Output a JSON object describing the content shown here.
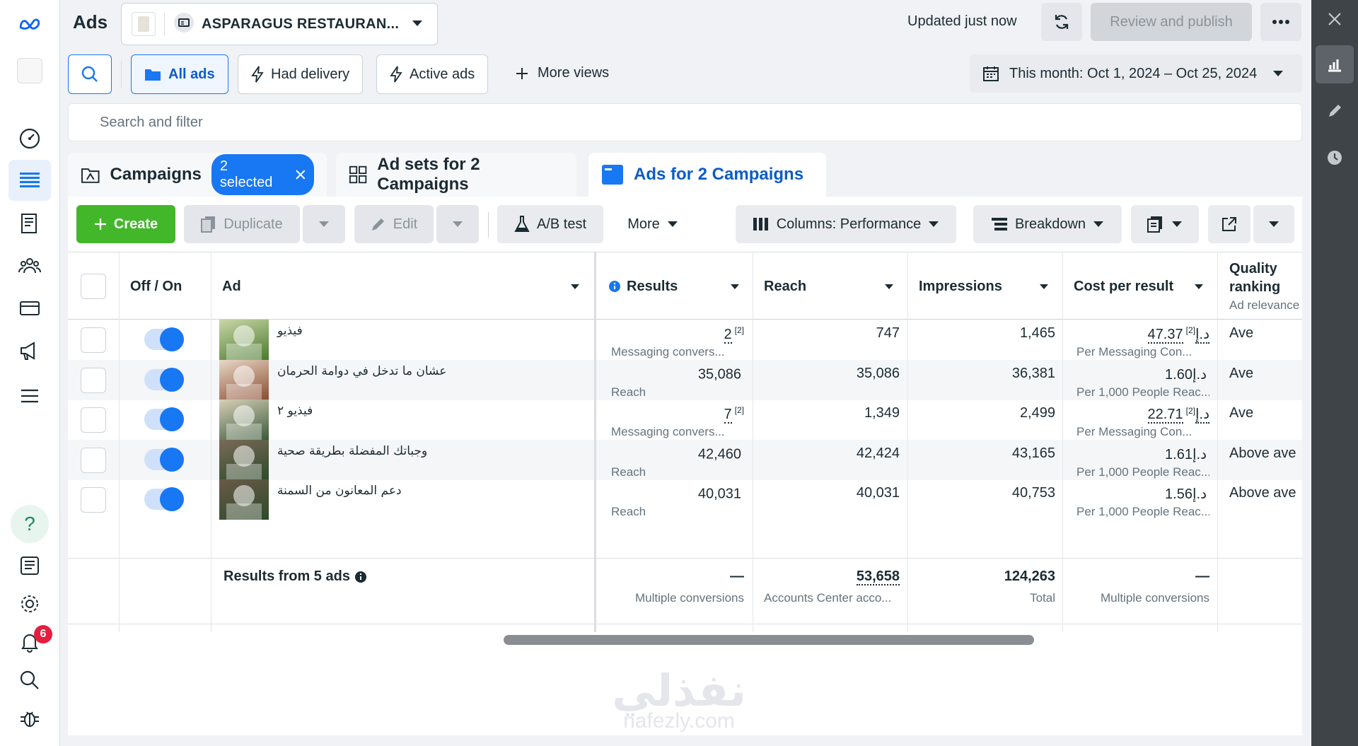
{
  "header": {
    "title": "Ads",
    "account_name": "ASPARAGUS RESTAURAN...",
    "updated": "Updated just now",
    "publish_label": "Review and publish"
  },
  "filters": {
    "all_ads": "All ads",
    "had_delivery": "Had delivery",
    "active_ads": "Active ads",
    "more_views": "More views",
    "date_range": "This month: Oct 1, 2024 – Oct 25, 2024",
    "search_placeholder": "Search and filter"
  },
  "tabs": {
    "campaigns": "Campaigns",
    "selected_pill": "2 selected",
    "ad_sets": "Ad sets for 2 Campaigns",
    "ads": "Ads for 2 Campaigns"
  },
  "toolbar": {
    "create": "Create",
    "duplicate": "Duplicate",
    "edit": "Edit",
    "ab_test": "A/B test",
    "more": "More",
    "columns": "Columns: Performance",
    "breakdown": "Breakdown"
  },
  "table": {
    "headers": {
      "off_on": "Off / On",
      "ad": "Ad",
      "results": "Results",
      "reach": "Reach",
      "impressions": "Impressions",
      "cost_per_result": "Cost per result",
      "quality_ranking": "Quality ranking",
      "quality_sub": "Ad relevance"
    },
    "rows": [
      {
        "name": "فيذيو",
        "results": "2",
        "results_fn": "[2]",
        "results_sub": "Messaging convers...",
        "reach": "747",
        "impressions": "1,465",
        "cost": "47.37د.إ",
        "cost_fn": "[2]",
        "cost_sub": "Per Messaging Con...",
        "quality": "Ave"
      },
      {
        "name": "عشان ما تدخل في دوامة الحرمان",
        "results": "35,086",
        "results_fn": "",
        "results_sub": "Reach",
        "reach": "35,086",
        "impressions": "36,381",
        "cost": "1.60د.إ",
        "cost_fn": "",
        "cost_sub": "Per 1,000 People Reac...",
        "quality": "Ave"
      },
      {
        "name": "فيذيو ٢",
        "results": "7",
        "results_fn": "[2]",
        "results_sub": "Messaging convers...",
        "reach": "1,349",
        "impressions": "2,499",
        "cost": "22.71د.إ",
        "cost_fn": "[2]",
        "cost_sub": "Per Messaging Con...",
        "quality": "Ave"
      },
      {
        "name": "وجباتك المفضلة بطريقة صحية",
        "results": "42,460",
        "results_fn": "",
        "results_sub": "Reach",
        "reach": "42,424",
        "impressions": "43,165",
        "cost": "1.61د.إ",
        "cost_fn": "",
        "cost_sub": "Per 1,000 People Reac...",
        "quality": "Above ave"
      },
      {
        "name": "دعم المعانون من السمنة",
        "results": "40,031",
        "results_fn": "",
        "results_sub": "Reach",
        "reach": "40,031",
        "impressions": "40,753",
        "cost": "1.56د.إ",
        "cost_fn": "",
        "cost_sub": "Per 1,000 People Reac...",
        "quality": "Above ave"
      }
    ],
    "summary": {
      "label": "Results from 5 ads",
      "results": "—",
      "results_sub": "Multiple conversions",
      "reach": "53,658",
      "reach_sub": "Accounts Center acco...",
      "impressions": "124,263",
      "impressions_sub": "Total",
      "cost": "—",
      "cost_sub": "Multiple conversions"
    }
  },
  "notifications": {
    "count": "6"
  },
  "watermark": {
    "arabic": "نفذلي",
    "latin": "nafezly.com"
  }
}
